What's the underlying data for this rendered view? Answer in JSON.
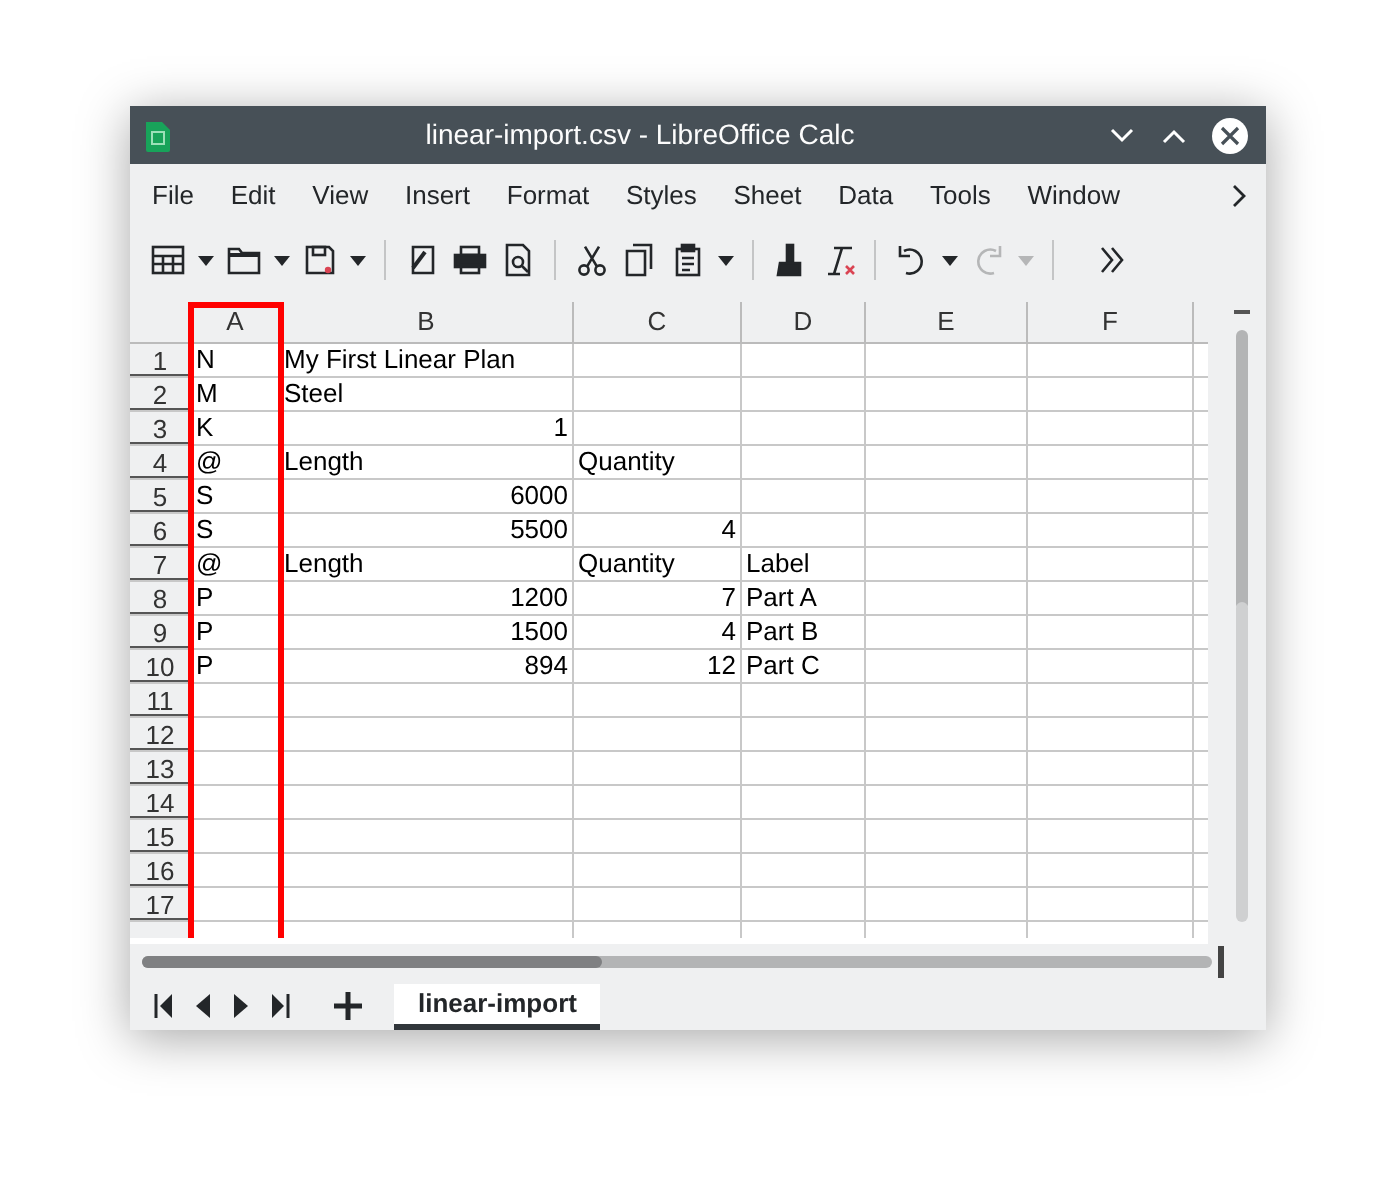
{
  "window": {
    "title": "linear-import.csv - LibreOffice Calc"
  },
  "menu": [
    "File",
    "Edit",
    "View",
    "Insert",
    "Format",
    "Styles",
    "Sheet",
    "Data",
    "Tools",
    "Window"
  ],
  "columns": [
    {
      "label": "A",
      "highlighted": true
    },
    {
      "label": "B",
      "highlighted": false
    },
    {
      "label": "C",
      "highlighted": false
    },
    {
      "label": "D",
      "highlighted": false
    },
    {
      "label": "E",
      "highlighted": false
    },
    {
      "label": "F",
      "highlighted": false
    }
  ],
  "rows": [
    {
      "number": "1",
      "cells": [
        {
          "text": "N",
          "kind": "text"
        },
        {
          "text": "My First Linear Plan",
          "kind": "text"
        },
        null,
        null
      ]
    },
    {
      "number": "2",
      "cells": [
        {
          "text": "M",
          "kind": "text"
        },
        {
          "text": "Steel",
          "kind": "text"
        },
        null,
        null
      ]
    },
    {
      "number": "3",
      "cells": [
        {
          "text": "K",
          "kind": "text"
        },
        {
          "text": "1",
          "kind": "number"
        },
        null,
        null
      ]
    },
    {
      "number": "4",
      "cells": [
        {
          "text": "@",
          "kind": "text"
        },
        {
          "text": "Length",
          "kind": "text"
        },
        {
          "text": "Quantity",
          "kind": "text"
        },
        null
      ]
    },
    {
      "number": "5",
      "cells": [
        {
          "text": "S",
          "kind": "text"
        },
        {
          "text": "6000",
          "kind": "number"
        },
        null,
        null
      ]
    },
    {
      "number": "6",
      "cells": [
        {
          "text": "S",
          "kind": "text"
        },
        {
          "text": "5500",
          "kind": "number"
        },
        {
          "text": "4",
          "kind": "number"
        },
        null
      ]
    },
    {
      "number": "7",
      "cells": [
        {
          "text": "@",
          "kind": "text"
        },
        {
          "text": "Length",
          "kind": "text"
        },
        {
          "text": "Quantity",
          "kind": "text"
        },
        {
          "text": "Label",
          "kind": "text"
        }
      ]
    },
    {
      "number": "8",
      "cells": [
        {
          "text": "P",
          "kind": "text"
        },
        {
          "text": "1200",
          "kind": "number"
        },
        {
          "text": "7",
          "kind": "number"
        },
        {
          "text": "Part A",
          "kind": "text"
        }
      ]
    },
    {
      "number": "9",
      "cells": [
        {
          "text": "P",
          "kind": "text"
        },
        {
          "text": "1500",
          "kind": "number"
        },
        {
          "text": "4",
          "kind": "number"
        },
        {
          "text": "Part B",
          "kind": "text"
        }
      ]
    },
    {
      "number": "10",
      "cells": [
        {
          "text": "P",
          "kind": "text"
        },
        {
          "text": "894",
          "kind": "number"
        },
        {
          "text": "12",
          "kind": "number"
        },
        {
          "text": "Part C",
          "kind": "text"
        }
      ]
    },
    {
      "number": "11"
    },
    {
      "number": "12"
    },
    {
      "number": "13"
    },
    {
      "number": "14"
    },
    {
      "number": "15"
    },
    {
      "number": "16"
    },
    {
      "number": "17"
    }
  ],
  "sheet_tabs": [
    {
      "label": "linear-import",
      "selected": true
    }
  ]
}
